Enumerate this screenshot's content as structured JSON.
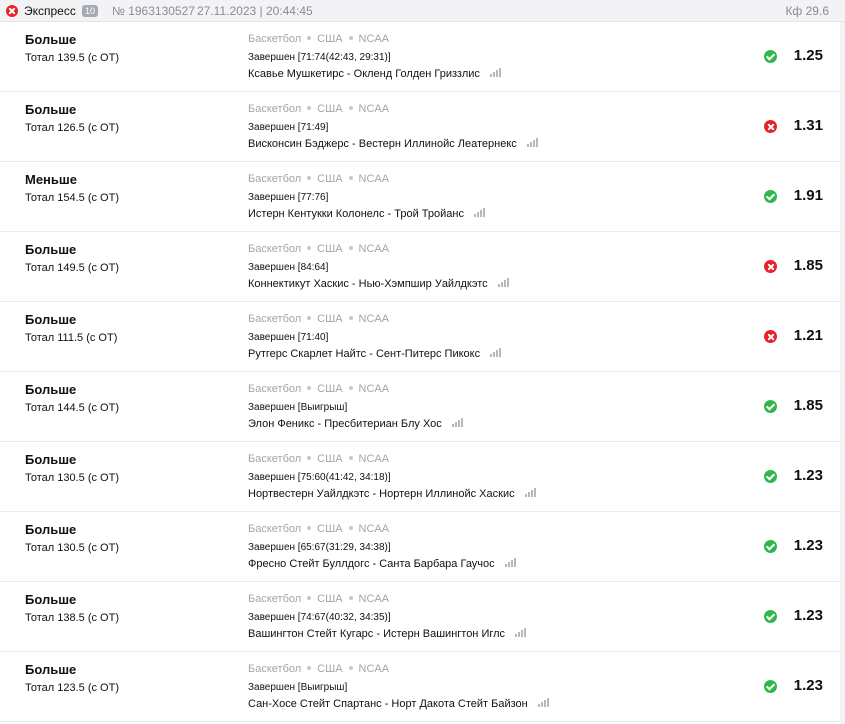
{
  "header": {
    "title": "Экспресс",
    "count": "10",
    "number": "№ 1963130527",
    "datetime": "27.11.2023 | 20:44:45",
    "total_coef": "Кф 29.6"
  },
  "meta": {
    "sport": "Баскетбол",
    "country": "США",
    "league": "NCAA"
  },
  "bets": [
    {
      "market": "Больше",
      "selection": "Тотал 139.5 (с ОТ)",
      "result": "Завершен [71:74(42:43, 29:31)]",
      "teams": "Ксавье Мушкетирс - Окленд Голден Гриззлис",
      "outcome": "win",
      "coef": "1.25"
    },
    {
      "market": "Больше",
      "selection": "Тотал 126.5 (с ОТ)",
      "result": "Завершен [71:49]",
      "teams": "Висконсин Бэджерс - Вестерн Иллинойс Леатернекс",
      "outcome": "lose",
      "coef": "1.31"
    },
    {
      "market": "Меньше",
      "selection": "Тотал 154.5 (с ОТ)",
      "result": "Завершен [77:76]",
      "teams": "Истерн Кентукки Колонелс - Трой Тройанс",
      "outcome": "win",
      "coef": "1.91"
    },
    {
      "market": "Больше",
      "selection": "Тотал 149.5 (с ОТ)",
      "result": "Завершен [84:64]",
      "teams": "Коннектикут Хаскис - Нью-Хэмпшир Уайлдкэтс",
      "outcome": "lose",
      "coef": "1.85"
    },
    {
      "market": "Больше",
      "selection": "Тотал 111.5 (с ОТ)",
      "result": "Завершен [71:40]",
      "teams": "Рутгерс Скарлет Найтс - Сент-Питерс Пикокс",
      "outcome": "lose",
      "coef": "1.21"
    },
    {
      "market": "Больше",
      "selection": "Тотал 144.5 (с ОТ)",
      "result": "Завершен [Выигрыш]",
      "teams": "Элон Феникс - Пресбитериан Блу Хос",
      "outcome": "win",
      "coef": "1.85"
    },
    {
      "market": "Больше",
      "selection": "Тотал 130.5 (с ОТ)",
      "result": "Завершен [75:60(41:42, 34:18)]",
      "teams": "Нортвестерн Уайлдкэтс - Нортерн Иллинойс Хаскис",
      "outcome": "win",
      "coef": "1.23"
    },
    {
      "market": "Больше",
      "selection": "Тотал 130.5 (с ОТ)",
      "result": "Завершен [65:67(31:29, 34:38)]",
      "teams": "Фресно Стейт Буллдогс - Санта Барбара Гаучос",
      "outcome": "win",
      "coef": "1.23"
    },
    {
      "market": "Больше",
      "selection": "Тотал 138.5 (с ОТ)",
      "result": "Завершен [74:67(40:32, 34:35)]",
      "teams": "Вашингтон Стейт Кугарс - Истерн Вашингтон Иглс",
      "outcome": "win",
      "coef": "1.23"
    },
    {
      "market": "Больше",
      "selection": "Тотал 123.5 (с ОТ)",
      "result": "Завершен [Выигрыш]",
      "teams": "Сан-Хосе Стейт Спартанс - Норт Дакота Стейт Байзон",
      "outcome": "win",
      "coef": "1.23"
    }
  ],
  "colors": {
    "win": "#2fb84a",
    "lose": "#e8222b",
    "muted": "#a3a5ab"
  },
  "icons": {
    "status": "close-circle-icon",
    "win": "check-circle-icon",
    "lose": "cross-circle-icon",
    "stats": "stats-bars-icon"
  }
}
